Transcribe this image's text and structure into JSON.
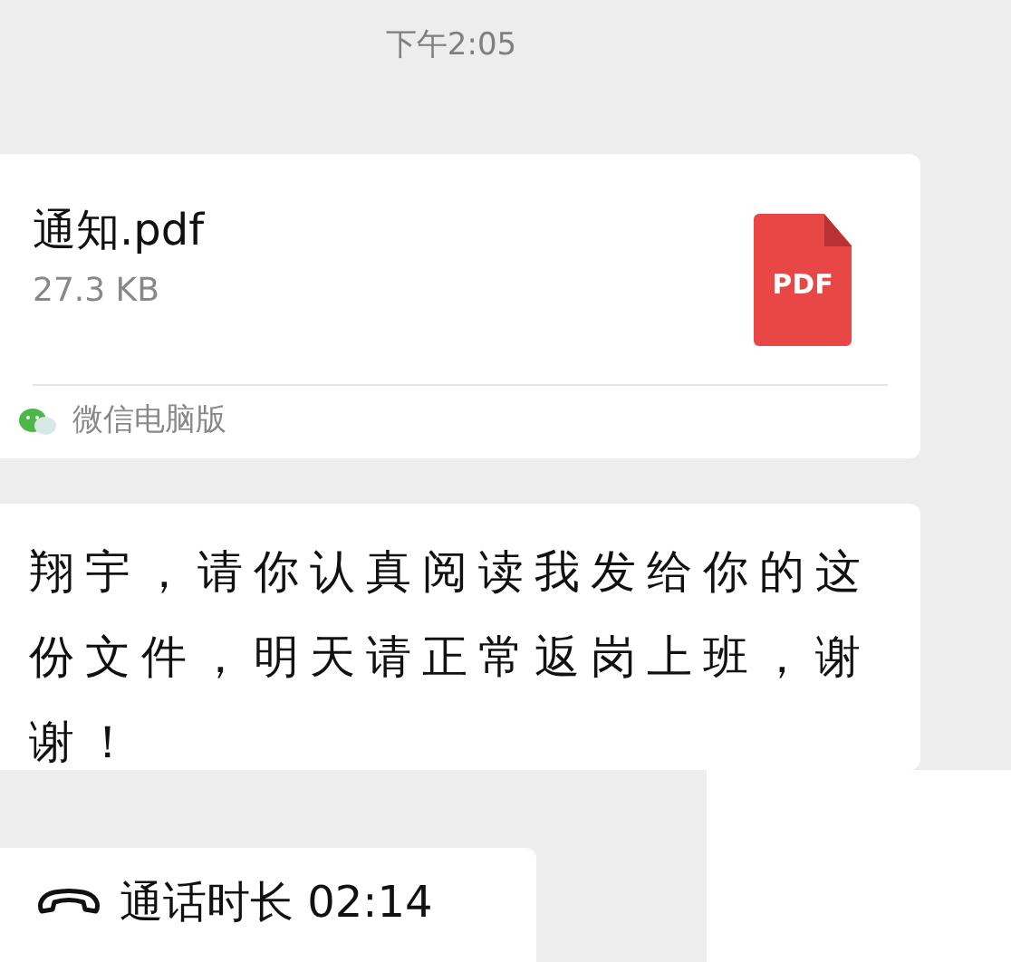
{
  "timestamp": "下午2:05",
  "file_message": {
    "name": "通知.pdf",
    "size": "27.3 KB",
    "file_type": "PDF",
    "source": "微信电脑版"
  },
  "text_message": "翔宇，请你认真阅读我发给你的这份文件，明天请正常返岗上班，谢谢！",
  "call_message": {
    "label": "通话时长 02:14"
  }
}
